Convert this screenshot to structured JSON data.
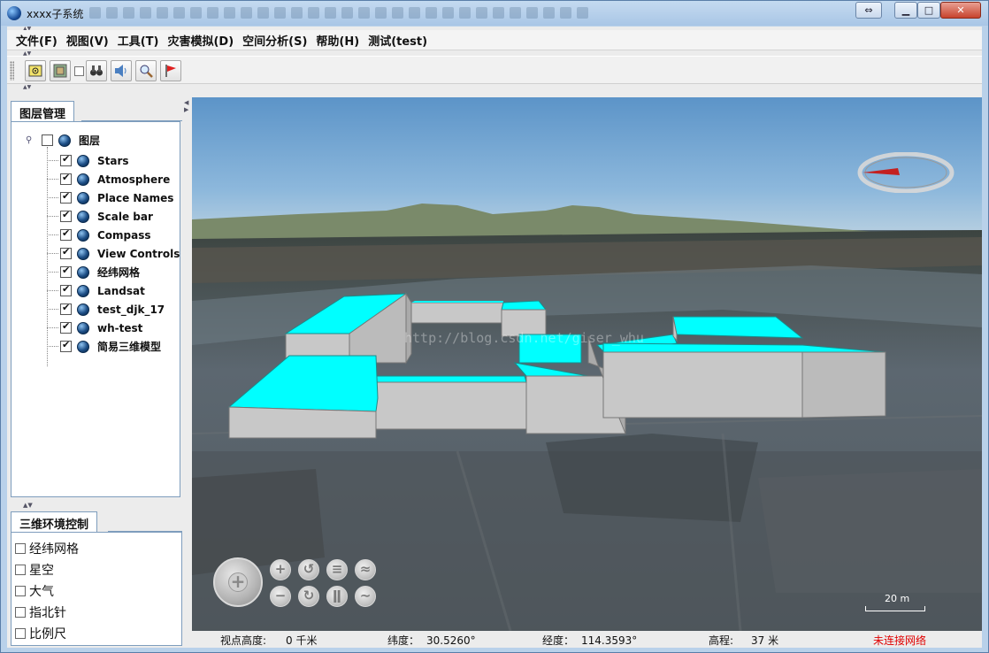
{
  "window": {
    "title": "xxxx子系统",
    "colors": {
      "title_bar": "#a9c6e6",
      "close_button": "#c7432d",
      "building_roof": "#00ffff",
      "building_wall": "#c8c8c8",
      "network_warning": "#e00000"
    }
  },
  "menu": [
    {
      "label": "文件(F)"
    },
    {
      "label": "视图(V)"
    },
    {
      "label": "工具(T)"
    },
    {
      "label": "灾害模拟(D)"
    },
    {
      "label": "空间分析(S)"
    },
    {
      "label": "帮助(H)"
    },
    {
      "label": "测试(test)"
    }
  ],
  "toolbar": {
    "buttons": [
      {
        "icon": "map-target-icon"
      },
      {
        "icon": "layers-icon"
      },
      {
        "icon": "binoculars-icon"
      },
      {
        "icon": "speaker-icon"
      },
      {
        "icon": "magnifier-icon"
      },
      {
        "icon": "red-flag-icon"
      }
    ]
  },
  "layer_panel": {
    "tab_label": "图层管理",
    "root": {
      "label": "图层",
      "checked": false
    },
    "layers": [
      {
        "label": "Stars",
        "checked": true
      },
      {
        "label": "Atmosphere",
        "checked": true
      },
      {
        "label": "Place Names",
        "checked": true
      },
      {
        "label": "Scale bar",
        "checked": true
      },
      {
        "label": "Compass",
        "checked": true
      },
      {
        "label": "View Controls",
        "checked": true
      },
      {
        "label": "经纬网格",
        "checked": true
      },
      {
        "label": "Landsat",
        "checked": true
      },
      {
        "label": "test_djk_17",
        "checked": true
      },
      {
        "label": "wh-test",
        "checked": true
      },
      {
        "label": "简易三维模型",
        "checked": true
      }
    ]
  },
  "env_panel": {
    "tab_label": "三维环境控制",
    "options": [
      {
        "label": "经纬网格",
        "checked": false
      },
      {
        "label": "星空",
        "checked": false
      },
      {
        "label": "大气",
        "checked": false
      },
      {
        "label": "指北针",
        "checked": false
      },
      {
        "label": "比例尺",
        "checked": false
      }
    ]
  },
  "viewport": {
    "watermark": "http://blog.csdn.net/giser_whu",
    "scale_label": "20 m",
    "nav_buttons": [
      "zoom-in",
      "rotate-left",
      "pitch",
      "tilt-up",
      "zoom-out",
      "rotate-right",
      "exaggeration",
      "tilt-down"
    ]
  },
  "status": {
    "eye_altitude_label": "视点高度:",
    "eye_altitude_value": "0 千米",
    "latitude_label": "纬度：",
    "latitude_value": "30.5260°",
    "longitude_label": "经度：",
    "longitude_value": "114.3593°",
    "elevation_label": "高程:",
    "elevation_value": "37 米",
    "network": "未连接网络"
  }
}
